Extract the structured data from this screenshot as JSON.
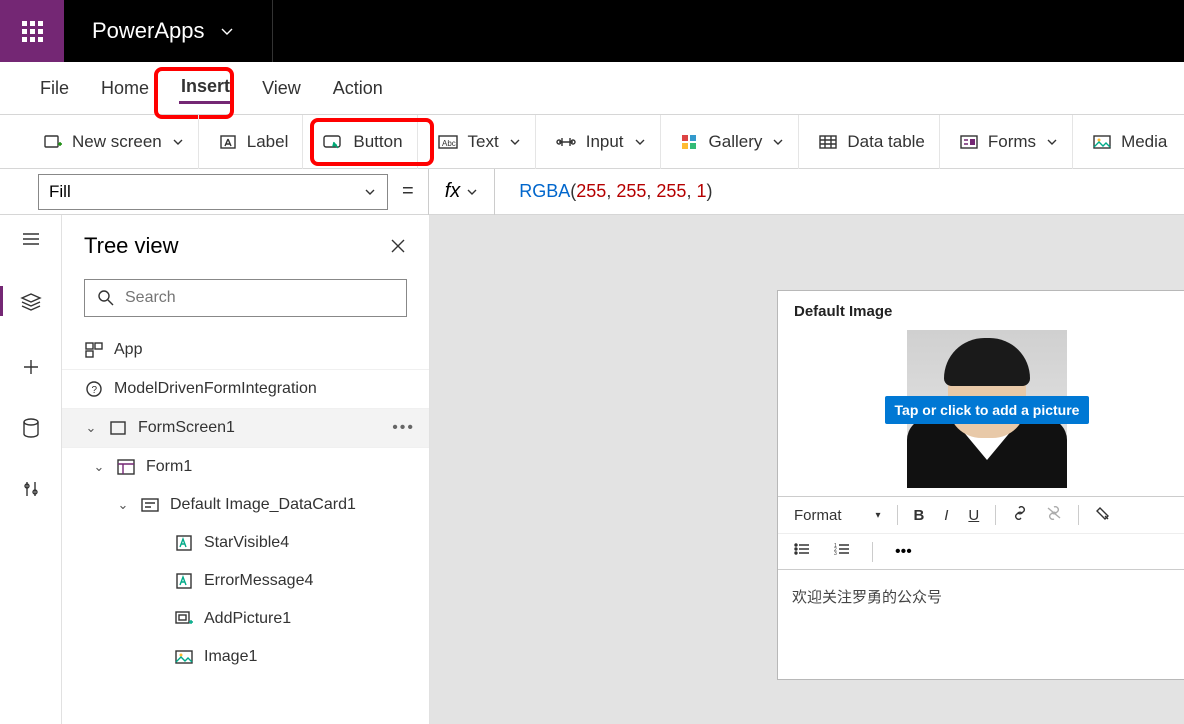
{
  "app": {
    "title": "PowerApps"
  },
  "menu": {
    "file": "File",
    "home": "Home",
    "insert": "Insert",
    "view": "View",
    "action": "Action"
  },
  "ribbon": {
    "newscreen": "New screen",
    "label": "Label",
    "button": "Button",
    "text": "Text",
    "input": "Input",
    "gallery": "Gallery",
    "datatable": "Data table",
    "forms": "Forms",
    "media": "Media"
  },
  "formula": {
    "property": "Fill",
    "fx": "fx",
    "fn": "RGBA",
    "args": [
      "255",
      "255",
      "255",
      "1"
    ]
  },
  "tree": {
    "title": "Tree view",
    "search_placeholder": "Search",
    "app": "App",
    "modeldriven": "ModelDrivenFormIntegration",
    "formscreen": "FormScreen1",
    "form1": "Form1",
    "datacard": "Default Image_DataCard1",
    "starvisible": "StarVisible4",
    "errormessage": "ErrorMessage4",
    "addpicture": "AddPicture1",
    "image1": "Image1"
  },
  "card": {
    "title": "Default Image",
    "add_picture": "Tap or click to add a picture",
    "format_label": "Format",
    "editor_text": "欢迎关注罗勇的公众号"
  }
}
